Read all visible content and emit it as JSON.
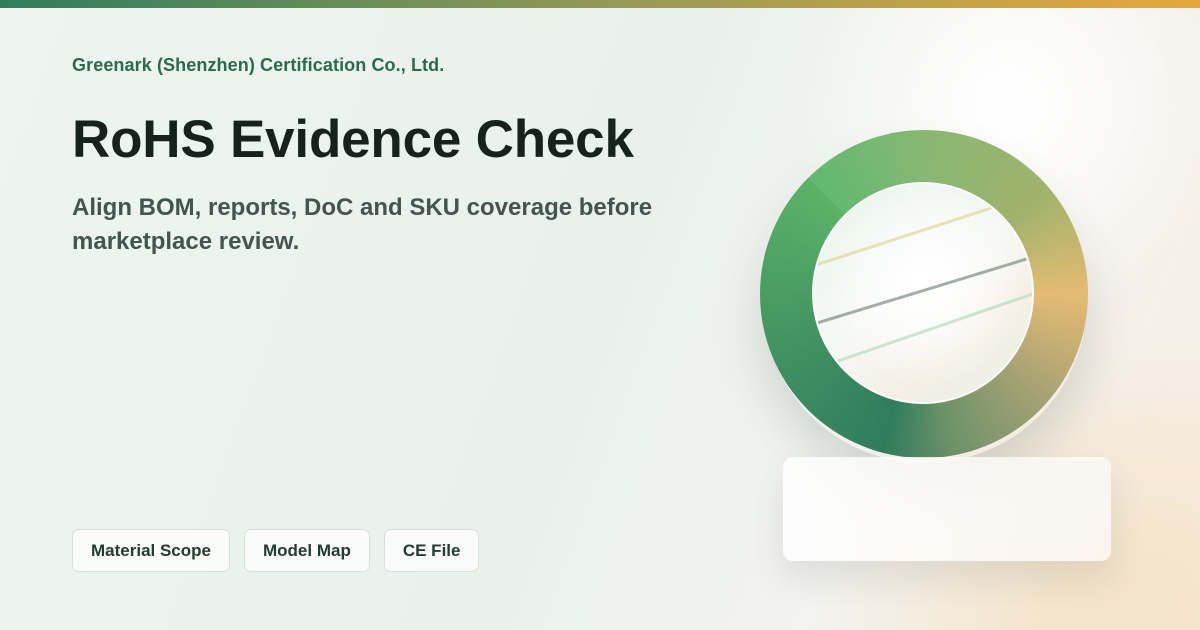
{
  "page": {
    "company": "Greenark (Shenzhen) Certification Co., Ltd.",
    "title": "RoHS Evidence Check",
    "subtitle": "Align BOM, reports, DoC and SKU coverage before marketplace review.",
    "chips": [
      {
        "label": "Material Scope"
      },
      {
        "label": "Model Map"
      },
      {
        "label": "CE File"
      }
    ]
  },
  "visual": {
    "top_strip_colors": [
      "#2f7d5d",
      "#9b9b55",
      "#e6a73d"
    ],
    "ring_colors": [
      "#5bb267",
      "#a0b26c",
      "#e4bb72",
      "#2f7d5d"
    ],
    "inner_line_colors": [
      "#dfd28e",
      "#7e8b86",
      "#b1dab8"
    ],
    "card_background": "#fbfaf7"
  }
}
